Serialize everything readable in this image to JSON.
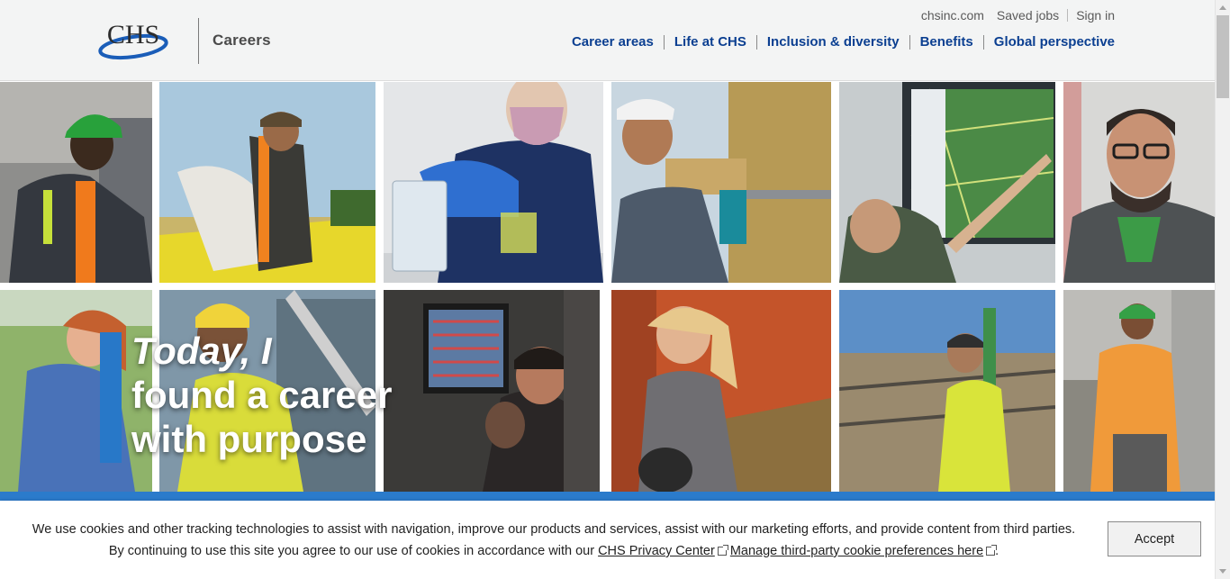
{
  "header": {
    "logo_text": "CHS",
    "section_label": "Careers",
    "utility_nav": [
      "chsinc.com",
      "Saved jobs",
      "Sign in"
    ],
    "main_nav": [
      "Career areas",
      "Life at CHS",
      "Inclusion & diversity",
      "Benefits",
      "Global perspective"
    ]
  },
  "hero": {
    "line1": "Today, I",
    "line2": "found a career",
    "line3": "with purpose",
    "accent_color": "#2878c8"
  },
  "cookie_banner": {
    "text_part1": "We use cookies and other tracking technologies to assist with navigation, improve our products and services, assist with our marketing efforts, and provide content from third parties. By continuing to use this site you agree to our use of cookies in accordance with our",
    "privacy_link": "CHS Privacy Center",
    "preferences_link": "Manage third-party cookie preferences here",
    "text_end": ".",
    "accept_label": "Accept"
  },
  "colors": {
    "brand_blue": "#0b3f91",
    "band_blue": "#2b7bcb"
  }
}
